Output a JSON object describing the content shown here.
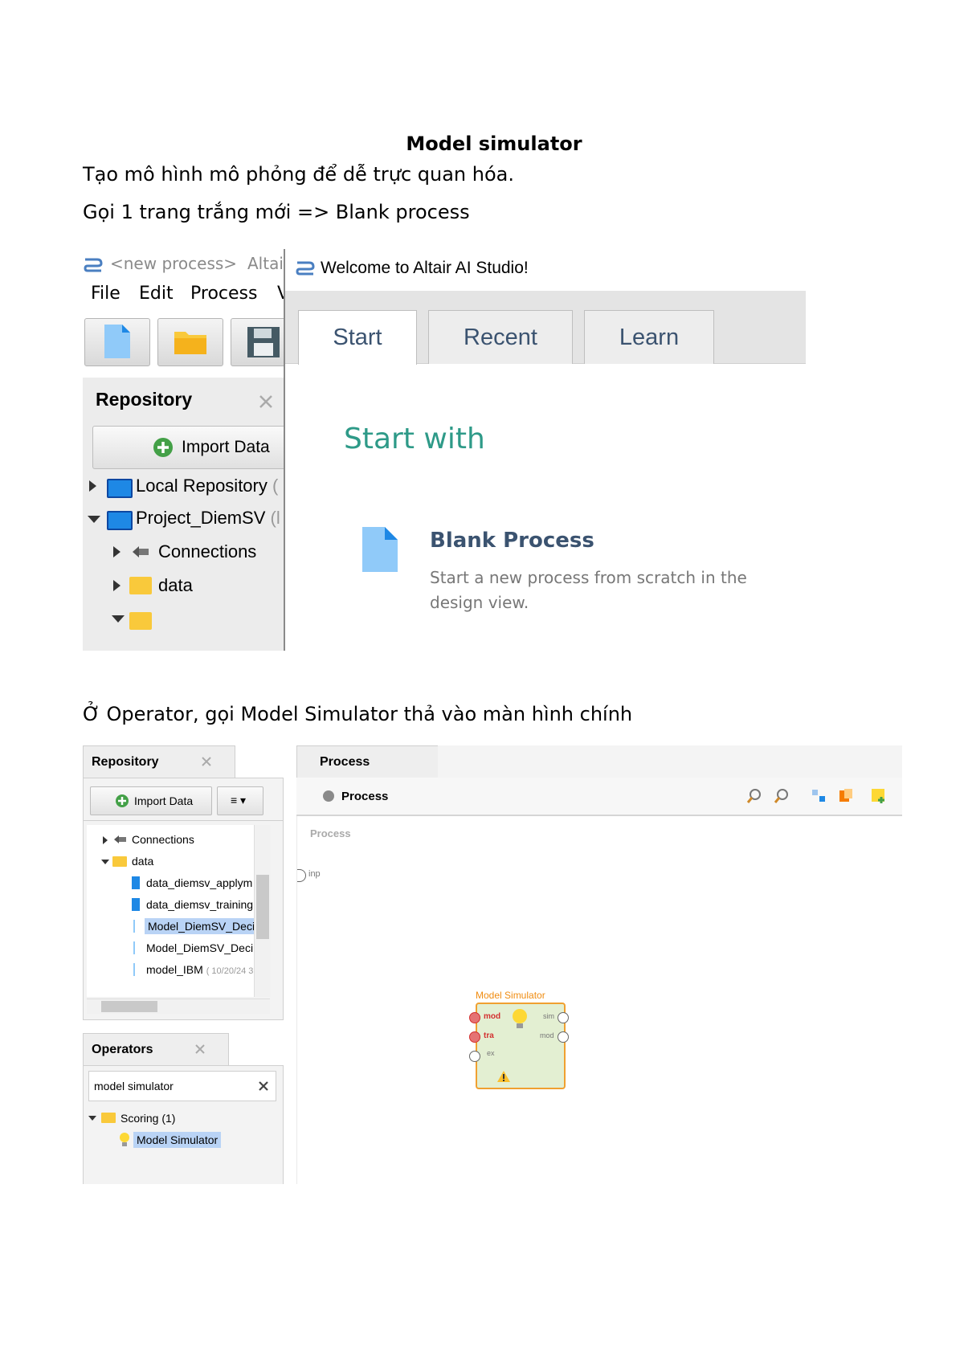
{
  "doc": {
    "title": "Model simulator",
    "p1": "Tạo mô hình mô phỏng để dễ trực quan hóa.",
    "p2": "Gọi 1 trang trắng mới => Blank process",
    "p3": "Ở Operator, gọi Model Simulator thả vào màn hình chính"
  },
  "shot1": {
    "title_left": "<new process>",
    "title_app": "Altai",
    "menu": [
      "File",
      "Edit",
      "Process",
      "V"
    ],
    "repo_title": "Repository",
    "import_btn": "Import Data",
    "tree": [
      "Local Repository",
      "Project_DiemSV",
      "Connections",
      "data"
    ],
    "tree_suffix": [
      "(",
      "(l"
    ],
    "welcome_title": "Welcome to Altair AI Studio!",
    "tabs": [
      "Start",
      "Recent",
      "Learn"
    ],
    "start_with": "Start with",
    "blank_title": "Blank Process",
    "blank_desc1": "Start a new process from scratch in the",
    "blank_desc2": "design view."
  },
  "shot2": {
    "repo_title": "Repository",
    "import_btn": "Import Data",
    "menu_btn": "≡ ▾",
    "tree": [
      "Connections",
      "data",
      "data_diemsv_applym",
      "data_diemsv_training",
      "Model_DiemSV_Deci",
      "Model_DiemSV_Deci",
      "model_IBM"
    ],
    "model_ibm_date": "( 10/20/24 3",
    "ops_title": "Operators",
    "search_value": "model simulator",
    "ops_tree_group": "Scoring (1)",
    "ops_tree_item": "Model Simulator",
    "process_tab": "Process",
    "process_crumb": "Process",
    "canvas_label": "Process",
    "inp_port": "inp",
    "op_title": "Model Simulator",
    "op_ports_in": [
      "mod",
      "tra",
      "ex"
    ],
    "op_ports_out": [
      "sim",
      "mod"
    ]
  },
  "colors": {
    "accent_green": "#2e9a88",
    "welcome_tab_text": "#3b5370",
    "operator_fill": "#e3efd2",
    "operator_border": "#f0a030",
    "operator_title": "#f08c10",
    "selection": "#b9d3f5"
  }
}
